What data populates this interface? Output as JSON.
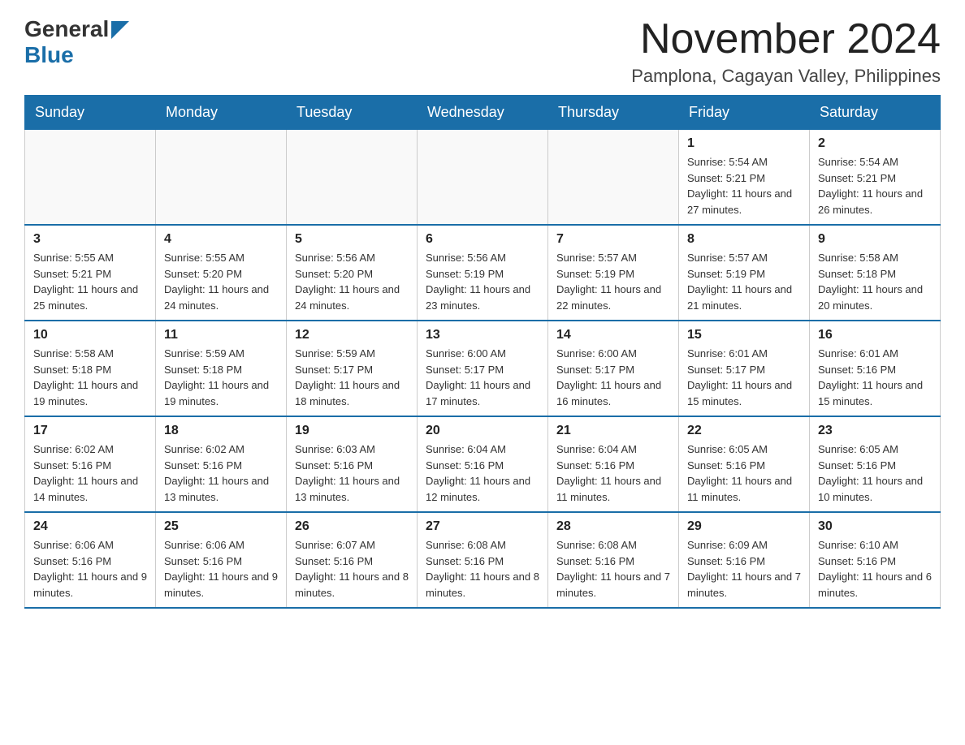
{
  "header": {
    "logo_general": "General",
    "logo_blue": "Blue",
    "month_title": "November 2024",
    "location": "Pamplona, Cagayan Valley, Philippines"
  },
  "weekdays": [
    "Sunday",
    "Monday",
    "Tuesday",
    "Wednesday",
    "Thursday",
    "Friday",
    "Saturday"
  ],
  "weeks": [
    [
      {
        "day": "",
        "info": ""
      },
      {
        "day": "",
        "info": ""
      },
      {
        "day": "",
        "info": ""
      },
      {
        "day": "",
        "info": ""
      },
      {
        "day": "",
        "info": ""
      },
      {
        "day": "1",
        "info": "Sunrise: 5:54 AM\nSunset: 5:21 PM\nDaylight: 11 hours and 27 minutes."
      },
      {
        "day": "2",
        "info": "Sunrise: 5:54 AM\nSunset: 5:21 PM\nDaylight: 11 hours and 26 minutes."
      }
    ],
    [
      {
        "day": "3",
        "info": "Sunrise: 5:55 AM\nSunset: 5:21 PM\nDaylight: 11 hours and 25 minutes."
      },
      {
        "day": "4",
        "info": "Sunrise: 5:55 AM\nSunset: 5:20 PM\nDaylight: 11 hours and 24 minutes."
      },
      {
        "day": "5",
        "info": "Sunrise: 5:56 AM\nSunset: 5:20 PM\nDaylight: 11 hours and 24 minutes."
      },
      {
        "day": "6",
        "info": "Sunrise: 5:56 AM\nSunset: 5:19 PM\nDaylight: 11 hours and 23 minutes."
      },
      {
        "day": "7",
        "info": "Sunrise: 5:57 AM\nSunset: 5:19 PM\nDaylight: 11 hours and 22 minutes."
      },
      {
        "day": "8",
        "info": "Sunrise: 5:57 AM\nSunset: 5:19 PM\nDaylight: 11 hours and 21 minutes."
      },
      {
        "day": "9",
        "info": "Sunrise: 5:58 AM\nSunset: 5:18 PM\nDaylight: 11 hours and 20 minutes."
      }
    ],
    [
      {
        "day": "10",
        "info": "Sunrise: 5:58 AM\nSunset: 5:18 PM\nDaylight: 11 hours and 19 minutes."
      },
      {
        "day": "11",
        "info": "Sunrise: 5:59 AM\nSunset: 5:18 PM\nDaylight: 11 hours and 19 minutes."
      },
      {
        "day": "12",
        "info": "Sunrise: 5:59 AM\nSunset: 5:17 PM\nDaylight: 11 hours and 18 minutes."
      },
      {
        "day": "13",
        "info": "Sunrise: 6:00 AM\nSunset: 5:17 PM\nDaylight: 11 hours and 17 minutes."
      },
      {
        "day": "14",
        "info": "Sunrise: 6:00 AM\nSunset: 5:17 PM\nDaylight: 11 hours and 16 minutes."
      },
      {
        "day": "15",
        "info": "Sunrise: 6:01 AM\nSunset: 5:17 PM\nDaylight: 11 hours and 15 minutes."
      },
      {
        "day": "16",
        "info": "Sunrise: 6:01 AM\nSunset: 5:16 PM\nDaylight: 11 hours and 15 minutes."
      }
    ],
    [
      {
        "day": "17",
        "info": "Sunrise: 6:02 AM\nSunset: 5:16 PM\nDaylight: 11 hours and 14 minutes."
      },
      {
        "day": "18",
        "info": "Sunrise: 6:02 AM\nSunset: 5:16 PM\nDaylight: 11 hours and 13 minutes."
      },
      {
        "day": "19",
        "info": "Sunrise: 6:03 AM\nSunset: 5:16 PM\nDaylight: 11 hours and 13 minutes."
      },
      {
        "day": "20",
        "info": "Sunrise: 6:04 AM\nSunset: 5:16 PM\nDaylight: 11 hours and 12 minutes."
      },
      {
        "day": "21",
        "info": "Sunrise: 6:04 AM\nSunset: 5:16 PM\nDaylight: 11 hours and 11 minutes."
      },
      {
        "day": "22",
        "info": "Sunrise: 6:05 AM\nSunset: 5:16 PM\nDaylight: 11 hours and 11 minutes."
      },
      {
        "day": "23",
        "info": "Sunrise: 6:05 AM\nSunset: 5:16 PM\nDaylight: 11 hours and 10 minutes."
      }
    ],
    [
      {
        "day": "24",
        "info": "Sunrise: 6:06 AM\nSunset: 5:16 PM\nDaylight: 11 hours and 9 minutes."
      },
      {
        "day": "25",
        "info": "Sunrise: 6:06 AM\nSunset: 5:16 PM\nDaylight: 11 hours and 9 minutes."
      },
      {
        "day": "26",
        "info": "Sunrise: 6:07 AM\nSunset: 5:16 PM\nDaylight: 11 hours and 8 minutes."
      },
      {
        "day": "27",
        "info": "Sunrise: 6:08 AM\nSunset: 5:16 PM\nDaylight: 11 hours and 8 minutes."
      },
      {
        "day": "28",
        "info": "Sunrise: 6:08 AM\nSunset: 5:16 PM\nDaylight: 11 hours and 7 minutes."
      },
      {
        "day": "29",
        "info": "Sunrise: 6:09 AM\nSunset: 5:16 PM\nDaylight: 11 hours and 7 minutes."
      },
      {
        "day": "30",
        "info": "Sunrise: 6:10 AM\nSunset: 5:16 PM\nDaylight: 11 hours and 6 minutes."
      }
    ]
  ]
}
